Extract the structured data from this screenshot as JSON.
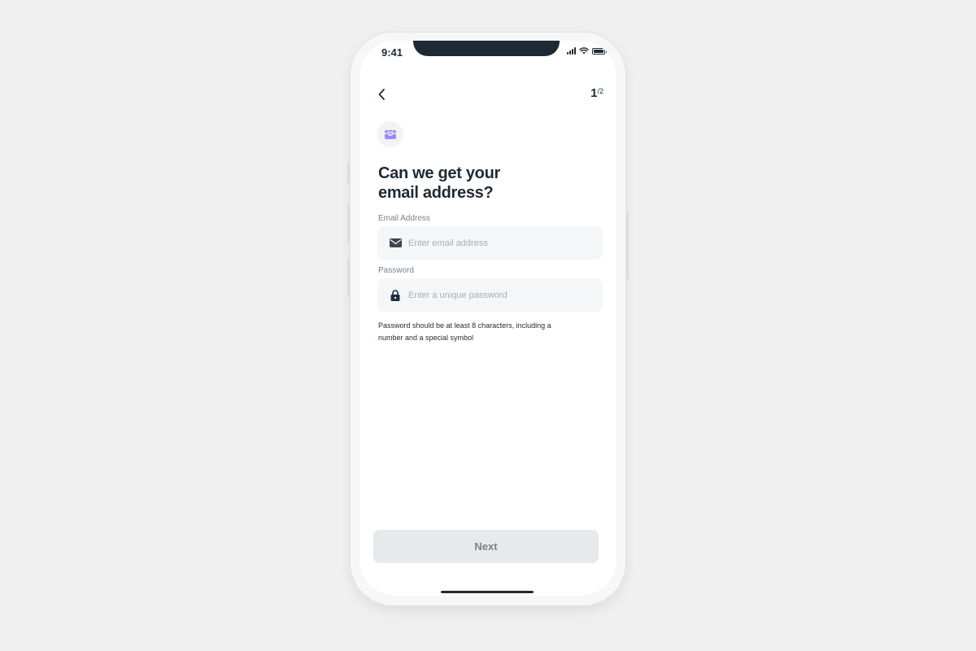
{
  "status_bar": {
    "time": "9:41"
  },
  "header": {
    "back_icon": "chevron-left-icon",
    "step_current": "1",
    "step_total": "/2"
  },
  "hero_icon": "mail-inbox-icon",
  "title": {
    "line1": "Can we get your",
    "line2": "email address?"
  },
  "email_field": {
    "label": "Email Address",
    "placeholder": "Enter email address",
    "value": "",
    "icon": "envelope-icon"
  },
  "password_field": {
    "label": "Password",
    "placeholder": "Enter a unique password",
    "value": "",
    "icon": "lock-icon"
  },
  "password_hint": {
    "line1": "Password should be at least 8 characters, including a",
    "line2": "number and a special symbol"
  },
  "next_button": {
    "label": "Next"
  },
  "colors": {
    "accent": "#9b8af5",
    "text": "#1f2a33",
    "field_bg": "#f5f6f8",
    "button_disabled_bg": "#e8e9ec"
  }
}
